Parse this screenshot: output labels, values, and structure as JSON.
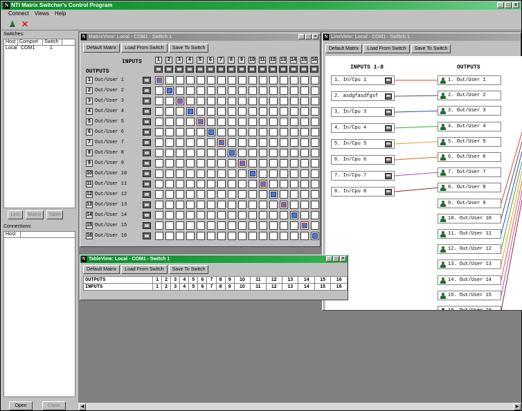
{
  "app": {
    "title": "NTI Matrix Switcher's Control Program"
  },
  "menu": [
    "Connect",
    "Views",
    "Help"
  ],
  "toolbar": {
    "icons": [
      "connect-icon",
      "disconnect-icon"
    ]
  },
  "left": {
    "switches_label": "Switches:",
    "switch_cols": [
      "Host",
      "Comport",
      "Switch"
    ],
    "switch_rows": [
      {
        "host": "Local",
        "comport": "COM1",
        "switch": "1"
      }
    ],
    "buttons": [
      "Line",
      "Matrix",
      "Table"
    ],
    "connections_label": "Connections:",
    "conn_cols": [
      "Host"
    ],
    "bottom_buttons": [
      "Open",
      "Close"
    ]
  },
  "matrix_window": {
    "title": "MatrixView: Local - COM1 - Switch 1",
    "buttons": [
      "Default Matrix",
      "Load From Switch",
      "Save To Switch"
    ],
    "inputs_label": "INPUTS",
    "outputs_label": "OUTPUTS",
    "output_labels": [
      "Out/User 1",
      "Out/User 2",
      "Out/User 3",
      "Out/User 4",
      "Out/User 5",
      "Out/User 6",
      "Out/User 7",
      "Out/User 8",
      "Out/User 9",
      "Out/User 10",
      "Out/User 11",
      "Out/User 12",
      "Out/User 13",
      "Out/User 14",
      "Out/User 15",
      "Out/User 16"
    ],
    "selected_input": [
      1,
      2,
      3,
      4,
      5,
      6,
      7,
      8,
      9,
      10,
      11,
      12,
      13,
      14,
      15,
      16
    ]
  },
  "wire_window": {
    "title": "LineView: Local - COM1 - Switch 1",
    "buttons": [
      "Default Matrix",
      "Load From Switch",
      "Save To Switch"
    ],
    "inputs_label": "INPUTS 1-8",
    "outputs_label": "OUTPUTS",
    "inputs": [
      "1. In/Cpu 1",
      "2. asdgfasdfgsf",
      "3. In/Cpu 3",
      "4. In/Cpu 4",
      "5. In/Cpu 5",
      "6. In/Cpu 6",
      "7. In/Cpu 7",
      "8. In/Cpu 8"
    ],
    "outputs": [
      "1. Out/User 1",
      "2. Out/User 2",
      "3. Out/User 3",
      "4. Out/User 4",
      "5. Out/User 5",
      "6. Out/User 6",
      "7. Out/User 7",
      "8. Out/User 8",
      "9. Out/User 9",
      "10. Out/User 10",
      "11. Out/User 11",
      "12. Out/User 12",
      "13. Out/User 13",
      "14. Out/User 14",
      "15. Out/User 15",
      "16. Out/User 16"
    ],
    "line_colors": [
      "#e0402a",
      "#505050",
      "#3040c0",
      "#30b030",
      "#e0a020",
      "#e06020",
      "#c040c0",
      "#8a2a20"
    ]
  },
  "table_window": {
    "title": "TableView: Local - COM1 - Switch 1",
    "buttons": [
      "Default Matrix",
      "Load From Switch",
      "Save To Switch"
    ],
    "row_outputs": "OUTPUTS",
    "row_inputs": "INPUTS",
    "outputs": [
      "1",
      "2",
      "3",
      "4",
      "5",
      "6",
      "7",
      "8",
      "9",
      "10",
      "11",
      "12",
      "13",
      "14",
      "15",
      "16"
    ],
    "inputs": [
      "1",
      "2",
      "3",
      "4",
      "5",
      "6",
      "7",
      "8",
      "9",
      "10",
      "11",
      "12",
      "13",
      "14",
      "15",
      "16"
    ]
  }
}
